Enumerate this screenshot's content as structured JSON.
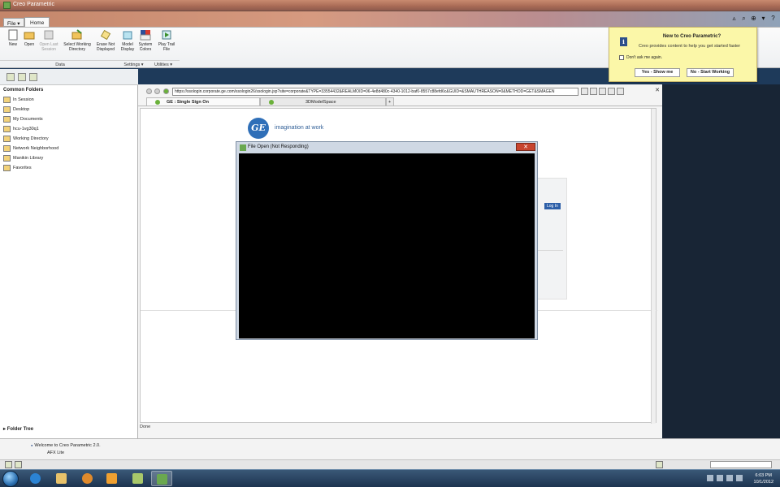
{
  "window": {
    "title": "Creo Parametric"
  },
  "ribbon": {
    "file_label": "File ▾",
    "home_tab": "Home",
    "buttons": [
      {
        "label": "New"
      },
      {
        "label": "Open"
      },
      {
        "label": "Open Last Session"
      },
      {
        "label": "Select Working Directory"
      },
      {
        "label": "Erase Not Displayed"
      },
      {
        "label": "Model Display"
      },
      {
        "label": "System Colors"
      },
      {
        "label": "Play Trail File"
      }
    ],
    "groups": {
      "data": "Data",
      "settings": "Settings ▾",
      "utilities": "Utilities ▾"
    }
  },
  "folders": {
    "header": "Common Folders",
    "items": [
      "In Session",
      "Desktop",
      "My Documents",
      "hcu-1vg30q1",
      "Working Directory",
      "Network Neighborhood",
      "Manikin Library",
      "Favorites"
    ],
    "tree_label": "Folder Tree"
  },
  "browser": {
    "url": "https://ssologin.corporate.ge.com/ssologin26/ssologin.jsp?site=corporate&TYPE=33554432&REALMOID=06-4e8d480c-4340-1012-baf0-8557c88efd6c&GUID=&SMAUTHREASON=0&METHOD=GET&SMAGEN",
    "tabs": [
      "GE : Single Sign On",
      "3DModelSpace"
    ],
    "tagline": "imagination at work",
    "login_button": "Log In",
    "status": "Done"
  },
  "notice": {
    "title": "New to Creo Parametric?",
    "body": "Creo provides content to help you get started faster",
    "checkbox": "Don't ask me again.",
    "yes_button": "Yes - Show me",
    "no_button": "No - Start Working"
  },
  "dialog": {
    "title": "File Open (Not Responding)"
  },
  "messages": {
    "line1": "Welcome to Creo Parametric 2.0.",
    "line2": "AFX Lite"
  },
  "taskbar": {
    "time": "6:03 PM",
    "date": "10/1/2012"
  }
}
